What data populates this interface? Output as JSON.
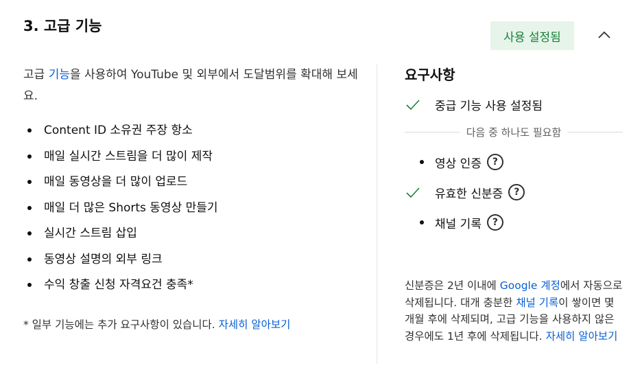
{
  "section": {
    "title": "3. 고급 기능",
    "status": "사용 설정됨"
  },
  "left": {
    "intro_pre": "고급 ",
    "intro_link": "기능",
    "intro_post": "을 사용하여 YouTube 및 외부에서 도달범위를 확대해 보세요.",
    "features": [
      "Content ID 소유권 주장 항소",
      "매일 실시간 스트림을 더 많이 제작",
      "매일 동영상을 더 많이 업로드",
      "매일 더 많은 Shorts 동영상 만들기",
      "실시간 스트림 삽입",
      "동영상 설명의 외부 링크",
      "수익 창출 신청 자격요건 충족*"
    ],
    "note_text": "* 일부 기능에는 추가 요구사항이 있습니다. ",
    "note_link": "자세히 알아보기"
  },
  "right": {
    "title": "요구사항",
    "requirement_main": "중급 기능 사용 설정됨",
    "separator": "다음 중 하나도 필요함",
    "options": [
      {
        "label": "영상 인증",
        "met": false
      },
      {
        "label": "유효한 신분증",
        "met": true
      },
      {
        "label": "채널 기록",
        "met": false
      }
    ],
    "help_glyph": "?",
    "info_1": "신분증은 2년 이내에 ",
    "info_link_1": "Google 계정",
    "info_2": "에서 자동으로 삭제됩니다. 대개 충분한 ",
    "info_link_2": "채널 기록",
    "info_3": "이 쌓이면 몇 개월 후에 삭제되며, 고급 기능을 사용하지 않은 경우에도 1년 후에 삭제됩니다. ",
    "info_link_3": "자세히 알아보기"
  },
  "colors": {
    "badge_bg": "#e6f4ea",
    "badge_text": "#188038",
    "link": "#065fd4",
    "check": "#188038"
  },
  "icons": {
    "collapse": "chevron-up-icon",
    "met": "checkmark-icon",
    "help": "help-circle-icon"
  }
}
